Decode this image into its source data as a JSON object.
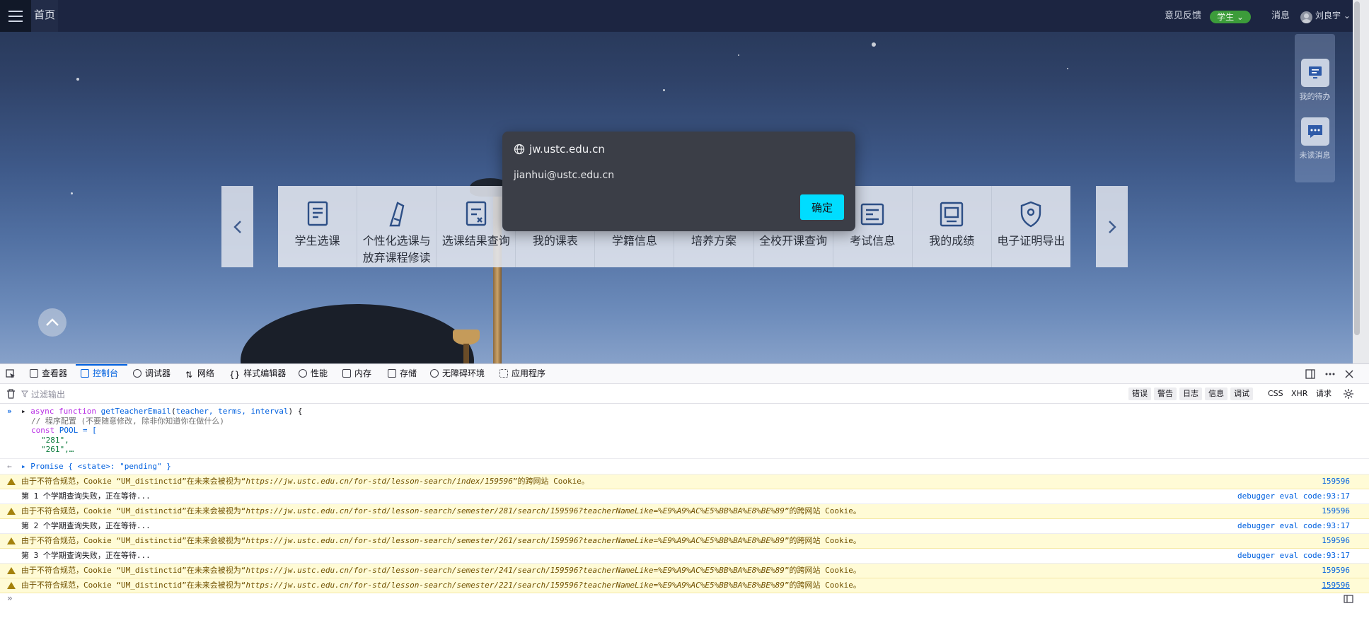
{
  "topbar": {
    "home_label": "首页",
    "feedback_label": "意见反馈",
    "role_label": "学生 ⌄",
    "messages_label": "消息",
    "user_name": "刘良宇 ⌄"
  },
  "side_panel": {
    "todo_label": "我的待办",
    "unread_label": "未读消息"
  },
  "carousel": {
    "prev_icon": "chevron-left-icon",
    "next_icon": "chevron-right-icon",
    "tiles": [
      {
        "label": "学生选课",
        "icon": "course-select-icon"
      },
      {
        "label": "个性化选课与放弃课程修读",
        "icon": "personalized-icon"
      },
      {
        "label": "选课结果查询",
        "icon": "result-query-icon"
      },
      {
        "label": "我的课表",
        "icon": "timetable-icon"
      },
      {
        "label": "学籍信息",
        "icon": "student-record-icon"
      },
      {
        "label": "培养方案",
        "icon": "training-plan-icon"
      },
      {
        "label": "全校开课查询",
        "icon": "all-courses-icon"
      },
      {
        "label": "考试信息",
        "icon": "exam-info-icon"
      },
      {
        "label": "我的成绩",
        "icon": "grades-icon"
      },
      {
        "label": "电子证明导出",
        "icon": "certificate-icon"
      }
    ]
  },
  "dialog": {
    "origin": "jw.ustc.edu.cn",
    "message": "jianhui@ustc.edu.cn",
    "ok_label": "确定"
  },
  "devtools": {
    "tabs": [
      {
        "label": "查看器",
        "icon": "inspector-icon"
      },
      {
        "label": "控制台",
        "icon": "console-icon",
        "active": true
      },
      {
        "label": "调试器",
        "icon": "debugger-icon"
      },
      {
        "label": "网络",
        "icon": "network-icon"
      },
      {
        "label": "样式编辑器",
        "icon": "style-editor-icon"
      },
      {
        "label": "性能",
        "icon": "performance-icon"
      },
      {
        "label": "内存",
        "icon": "memory-icon"
      },
      {
        "label": "存储",
        "icon": "storage-icon"
      },
      {
        "label": "无障碍环境",
        "icon": "accessibility-icon"
      },
      {
        "label": "应用程序",
        "icon": "application-icon"
      }
    ],
    "filter_placeholder": "过滤输出",
    "levels": [
      "错误",
      "警告",
      "日志",
      "信息",
      "调试"
    ],
    "extra_filters": [
      "CSS",
      "XHR",
      "请求"
    ],
    "code": {
      "line1_kw": "async function",
      "line1_fn": "getTeacherEmail",
      "line1_params": "teacher, terms, interval",
      "line2": "// 程序配置 (不要随意修改, 除非你知道你在做什么)",
      "line3": "POOL = [",
      "line4": "\"281\",",
      "line5": "\"261\",…"
    },
    "result": "Promise { <state>: \"pending\" }",
    "messages": [
      {
        "type": "warn",
        "prefix": "由于不符合规范，Cookie “UM_distinctid”在未来会被视为“",
        "url": "https://jw.ustc.edu.cn/for-std/lesson-search/index/159596",
        "suffix": "”的跨网站 Cookie。",
        "source": "159596"
      },
      {
        "type": "log",
        "text": "第 1 个学期查询失败，正在等待...",
        "source": "debugger eval code:93:17"
      },
      {
        "type": "warn",
        "prefix": "由于不符合规范，Cookie “UM_distinctid”在未来会被视为“",
        "url": "https://jw.ustc.edu.cn/for-std/lesson-search/semester/281/search/159596?teacherNameLike=%E9%A9%AC%E5%BB%BA%E8%BE%89",
        "suffix": "”的跨网站 Cookie。",
        "source": "159596"
      },
      {
        "type": "log",
        "text": "第 2 个学期查询失败，正在等待...",
        "source": "debugger eval code:93:17"
      },
      {
        "type": "warn",
        "prefix": "由于不符合规范，Cookie “UM_distinctid”在未来会被视为“",
        "url": "https://jw.ustc.edu.cn/for-std/lesson-search/semester/261/search/159596?teacherNameLike=%E9%A9%AC%E5%BB%BA%E8%BE%89",
        "suffix": "”的跨网站 Cookie。",
        "source": "159596"
      },
      {
        "type": "log",
        "text": "第 3 个学期查询失败，正在等待...",
        "source": "debugger eval code:93:17"
      },
      {
        "type": "warn",
        "prefix": "由于不符合规范，Cookie “UM_distinctid”在未来会被视为“",
        "url": "https://jw.ustc.edu.cn/for-std/lesson-search/semester/241/search/159596?teacherNameLike=%E9%A9%AC%E5%BB%BA%E8%BE%89",
        "suffix": "”的跨网站 Cookie。",
        "source": "159596"
      },
      {
        "type": "warn",
        "prefix": "由于不符合规范，Cookie “UM_distinctid”在未来会被视为“",
        "url": "https://jw.ustc.edu.cn/for-std/lesson-search/semester/221/search/159596?teacherNameLike=%E9%A9%AC%E5%BB%BA%E8%BE%89",
        "suffix": "”的跨网站 Cookie。",
        "source": "159596"
      }
    ]
  },
  "colors": {
    "accent": "#0060df",
    "dialog_ok": "#00ddff",
    "warning_bg": "#fffbd6",
    "role_badge": "#3c9c3a"
  }
}
